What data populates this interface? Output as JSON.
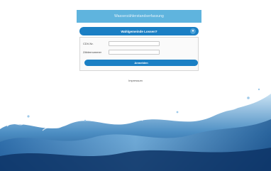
{
  "header": {
    "title": "Wasserzählerstandserfassung"
  },
  "municipality_select": {
    "label": "Wahlgemeinde Lossen?",
    "chevron_icon": "chevron-down-icon"
  },
  "form": {
    "fields": [
      {
        "label": "CDV-Nr.",
        "value": "",
        "placeholder": ""
      },
      {
        "label": "Zählernummer",
        "value": "",
        "placeholder": ""
      }
    ],
    "submit_label": "Anmelden"
  },
  "footer": {
    "imprint_label": "Impressum"
  },
  "colors": {
    "primary": "#1a7fc4",
    "header": "#5fb4de"
  }
}
